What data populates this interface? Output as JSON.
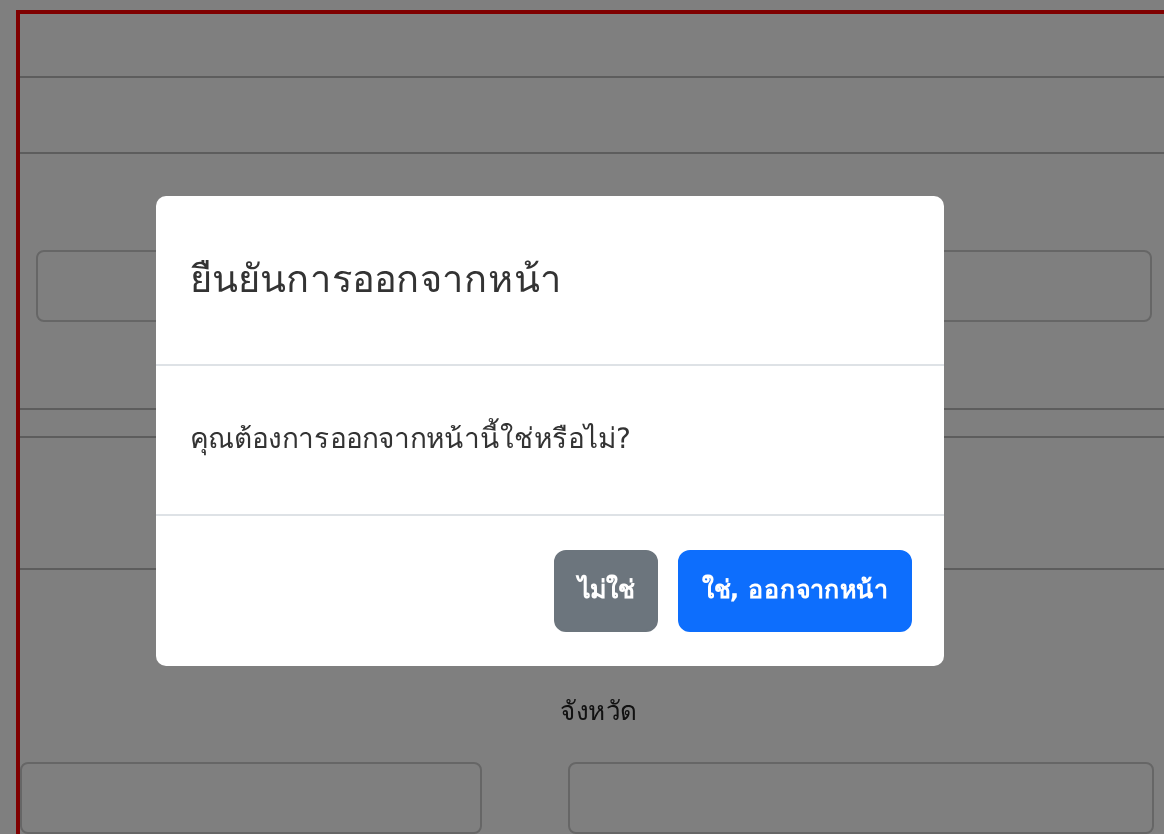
{
  "page": {
    "province_label": "จังหวัด"
  },
  "modal": {
    "title": "ยืนยันการออกจากหน้า",
    "message": "คุณต้องการออกจากหน้านี้ใช่หรือไม่?",
    "buttons": [
      {
        "label": "ไม่ใช่",
        "kind": "secondary"
      },
      {
        "label": "ใช่, ออกจากหน้า",
        "kind": "primary"
      }
    ]
  }
}
